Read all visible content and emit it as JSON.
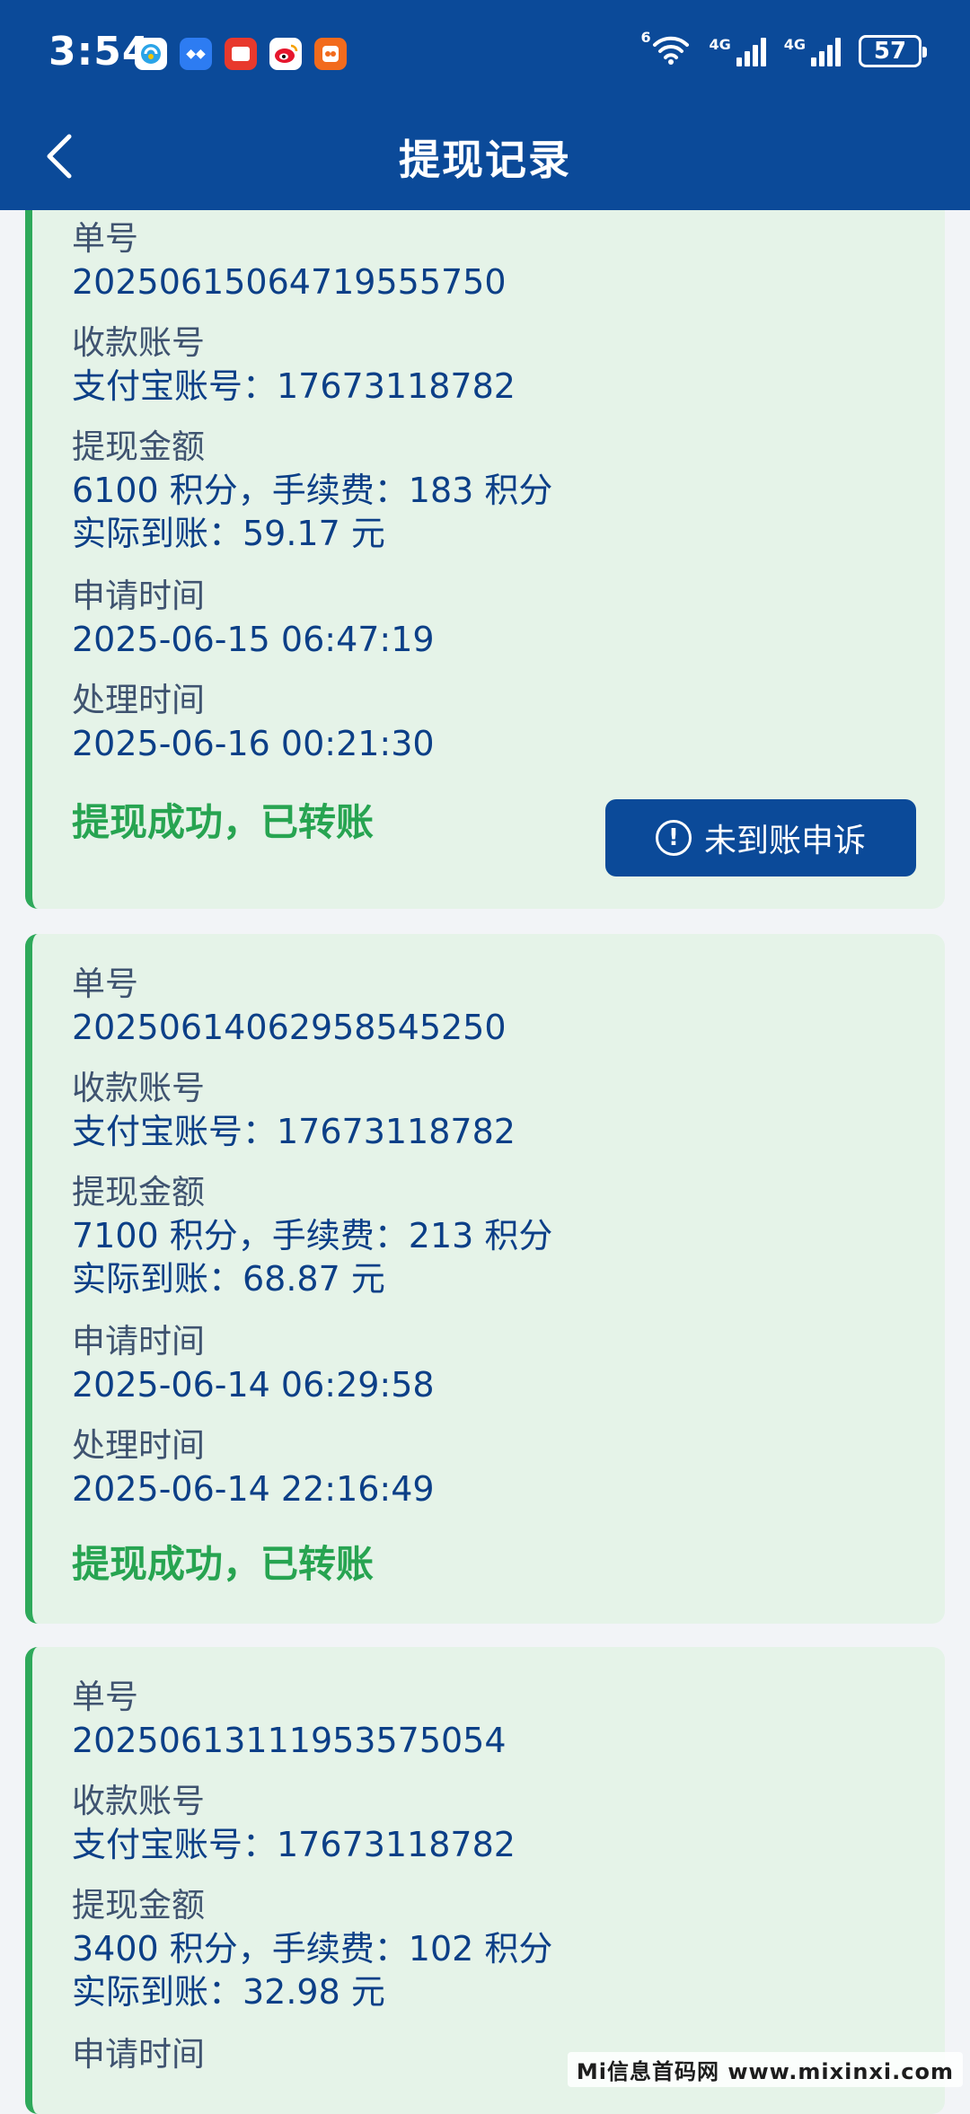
{
  "status_bar": {
    "time": "3:54",
    "battery": "57",
    "wifi_label": "6",
    "signal1_label": "4G",
    "signal2_label": "4G"
  },
  "header": {
    "title": "提现记录"
  },
  "labels": {
    "order_no": "单号",
    "account": "收款账号",
    "amount": "提现金额",
    "apply_time": "申请时间",
    "process_time": "处理时间"
  },
  "records": [
    {
      "order_no": "202506150647195557​50",
      "account": "支付宝账号：17673118782",
      "amount_line": "6100 积分，手续费：183 积分",
      "actual_line": "实际到账：59.17 元",
      "apply_time": "2025-06-15 06:47:19",
      "process_time": "2025-06-16 00:21:30",
      "status": "提现成功，已转账",
      "appeal_label": "未到账申诉"
    },
    {
      "order_no": "20250614062958545250",
      "account": "支付宝账号：17673118782",
      "amount_line": "7100 积分，手续费：213 积分",
      "actual_line": "实际到账：68.87 元",
      "apply_time": "2025-06-14 06:29:58",
      "process_time": "2025-06-14 22:16:49",
      "status": "提现成功，已转账"
    },
    {
      "order_no": "20250613111953575054",
      "account": "支付宝账号：17673118782",
      "amount_line": "3400 积分，手续费：102 积分",
      "actual_line": "实际到账：32.98 元"
    }
  ],
  "watermark": "Mi信息首码网 www.mixinxi.com",
  "colors": {
    "header": "#0b4a99",
    "card": "#e5f3e8",
    "success": "#27a451",
    "accent_border": "#2ea95a"
  }
}
